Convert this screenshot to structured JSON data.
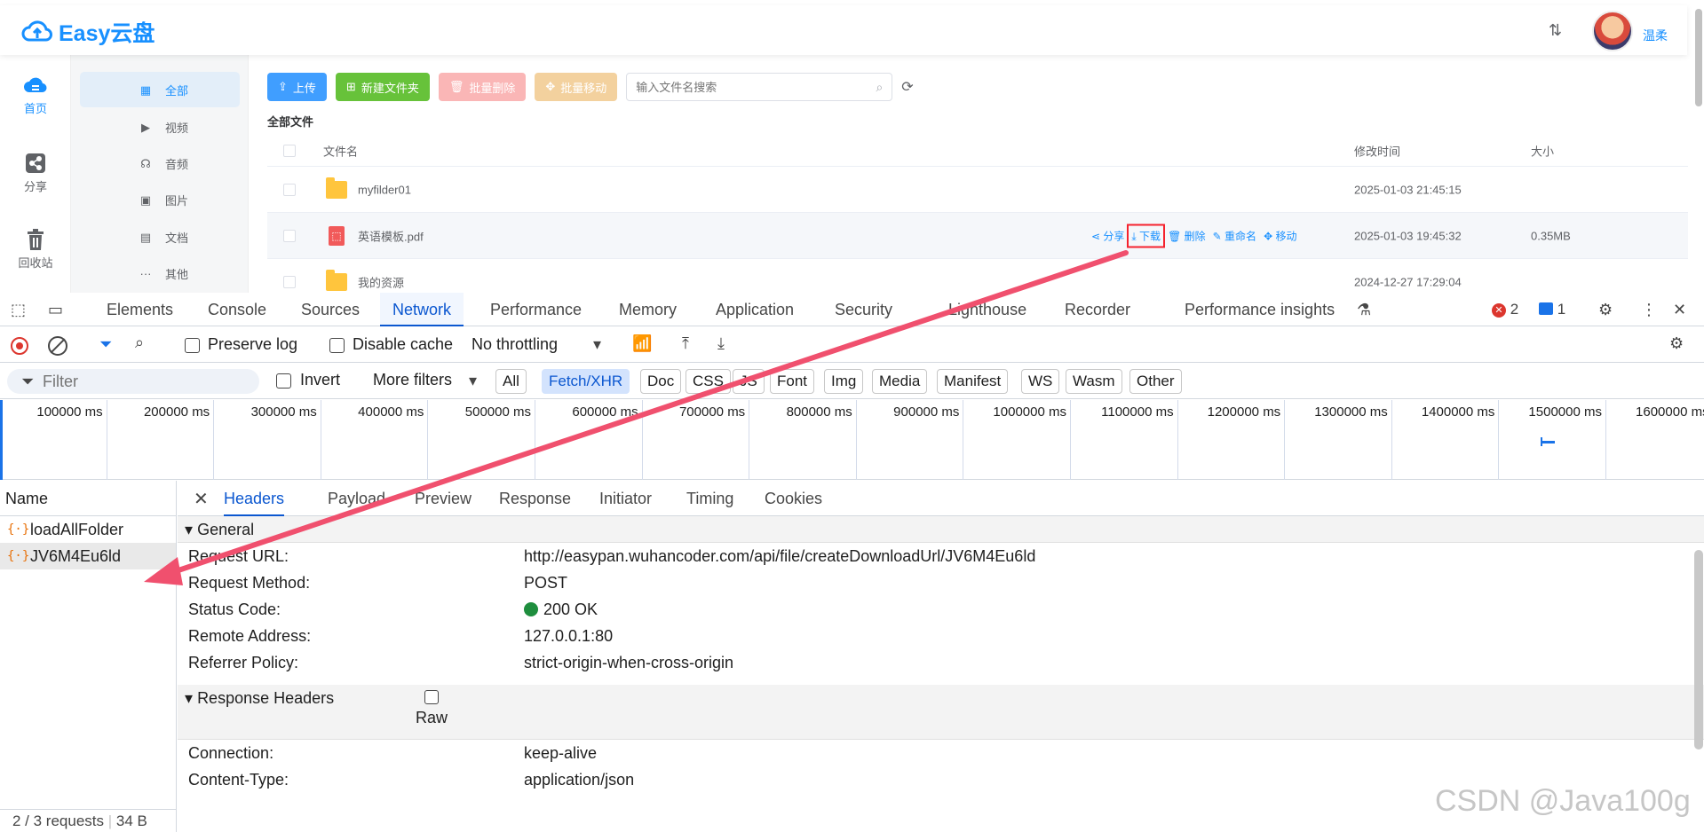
{
  "app": {
    "logo_text": "Easy云盘",
    "user_name": "温柔",
    "main_nav": [
      {
        "label": "首页"
      },
      {
        "label": "分享"
      },
      {
        "label": "回收站"
      }
    ],
    "sub_nav": [
      {
        "label": "全部",
        "icon": "grid-icon"
      },
      {
        "label": "视频",
        "icon": "play-icon"
      },
      {
        "label": "音频",
        "icon": "headphones-icon"
      },
      {
        "label": "图片",
        "icon": "image-icon"
      },
      {
        "label": "文档",
        "icon": "document-icon"
      },
      {
        "label": "其他",
        "icon": "more-icon"
      }
    ],
    "toolbar": {
      "upload": "上传",
      "new_folder": "新建文件夹",
      "batch_delete": "批量删除",
      "batch_move": "批量移动",
      "search_placeholder": "输入文件名搜索"
    },
    "breadcrumb": "全部文件",
    "table": {
      "col_name": "文件名",
      "col_modified": "修改时间",
      "col_size": "大小",
      "rows": [
        {
          "name": "myfilder01",
          "modified": "2025-01-03 21:45:15",
          "size": "",
          "type": "folder"
        },
        {
          "name": "英语模板.pdf",
          "modified": "2025-01-03 19:45:32",
          "size": "0.35MB",
          "type": "pdf"
        },
        {
          "name": "我的资源",
          "modified": "2024-12-27 17:29:04",
          "size": "",
          "type": "folder"
        }
      ],
      "row_actions": [
        "分享",
        "下载",
        "删除",
        "重命名",
        "移动"
      ]
    },
    "colors": {
      "primary": "#1890ff",
      "highlight_box": "#f5222d"
    }
  },
  "devtools": {
    "tabs": [
      "Elements",
      "Console",
      "Sources",
      "Network",
      "Performance",
      "Memory",
      "Application",
      "Security",
      "Lighthouse",
      "Recorder",
      "Performance insights"
    ],
    "active_tab": "Network",
    "error_count": "2",
    "message_count": "1",
    "toolbar": {
      "preserve_log": "Preserve log",
      "disable_cache": "Disable cache",
      "throttling": "No throttling"
    },
    "filter": {
      "placeholder": "Filter",
      "invert": "Invert",
      "more_filters": "More filters",
      "chips": [
        "All",
        "Fetch/XHR",
        "Doc",
        "CSS",
        "JS",
        "Font",
        "Img",
        "Media",
        "Manifest",
        "WS",
        "Wasm",
        "Other"
      ],
      "active_chip": "Fetch/XHR"
    },
    "timeline_ticks": [
      "100000 ms",
      "200000 ms",
      "300000 ms",
      "400000 ms",
      "500000 ms",
      "600000 ms",
      "700000 ms",
      "800000 ms",
      "900000 ms",
      "1000000 ms",
      "1100000 ms",
      "1200000 ms",
      "1300000 ms",
      "1400000 ms",
      "1500000 ms",
      "1600000 ms"
    ],
    "requests": {
      "header": "Name",
      "items": [
        "loadAllFolder",
        "JV6M4Eu6ld"
      ],
      "selected": "JV6M4Eu6ld",
      "footer": "2 / 3 requests",
      "footer_size": "34 B"
    },
    "detail_tabs": [
      "Headers",
      "Payload",
      "Preview",
      "Response",
      "Initiator",
      "Timing",
      "Cookies"
    ],
    "active_detail_tab": "Headers",
    "general": {
      "title": "General",
      "rows": [
        {
          "key": "Request URL:",
          "value": "http://easypan.wuhancoder.com/api/file/createDownloadUrl/JV6M4Eu6ld"
        },
        {
          "key": "Request Method:",
          "value": "POST"
        },
        {
          "key": "Status Code:",
          "value": "200 OK"
        },
        {
          "key": "Remote Address:",
          "value": "127.0.0.1:80"
        },
        {
          "key": "Referrer Policy:",
          "value": "strict-origin-when-cross-origin"
        }
      ]
    },
    "response_headers": {
      "title": "Response Headers",
      "raw_label": "Raw",
      "rows": [
        {
          "key": "Connection:",
          "value": "keep-alive"
        },
        {
          "key": "Content-Type:",
          "value": "application/json"
        }
      ]
    }
  },
  "watermark": "CSDN @Java100g"
}
